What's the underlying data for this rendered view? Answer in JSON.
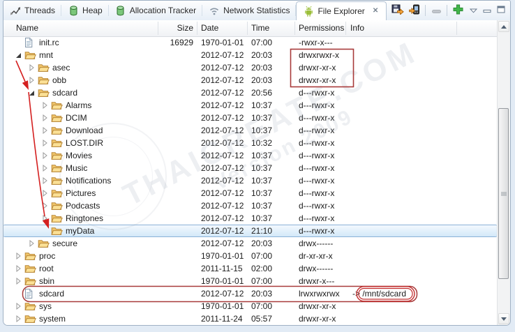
{
  "tabs": [
    {
      "label": "Threads",
      "icon": "threads-icon",
      "active": false
    },
    {
      "label": "Heap",
      "icon": "heap-icon",
      "active": false
    },
    {
      "label": "Allocation Tracker",
      "icon": "allocation-tracker-icon",
      "active": false
    },
    {
      "label": "Network Statistics",
      "icon": "network-statistics-icon",
      "active": false
    },
    {
      "label": "File Explorer",
      "icon": "android-icon",
      "active": true,
      "close_glyph": "✕"
    }
  ],
  "toolbar": {
    "buttons": [
      {
        "icon": "pull-file-icon"
      },
      {
        "icon": "push-file-icon"
      },
      {
        "icon": "delete-icon",
        "disabled": true
      },
      {
        "icon": "new-folder-icon"
      }
    ],
    "window_controls": [
      {
        "icon": "view-menu-icon"
      },
      {
        "icon": "minimize-icon"
      },
      {
        "icon": "maximize-icon"
      }
    ]
  },
  "columns": [
    "Name",
    "Size",
    "Date",
    "Time",
    "Permissions",
    "Info"
  ],
  "rows": [
    {
      "name": "init.rc",
      "icon": "file-icon",
      "level": 0,
      "expand": "none",
      "size": "16929",
      "date": "1970-01-01",
      "time": "07:00",
      "permissions": "-rwxr-x---",
      "info": "",
      "selected": false
    },
    {
      "name": "mnt",
      "icon": "folder-icon",
      "level": 0,
      "expand": "expanded",
      "size": "",
      "date": "2012-07-12",
      "time": "20:03",
      "permissions": "drwxrwxr-x",
      "info": "",
      "selected": false
    },
    {
      "name": "asec",
      "icon": "folder-icon",
      "level": 1,
      "expand": "collapsed",
      "size": "",
      "date": "2012-07-12",
      "time": "20:03",
      "permissions": "drwxr-xr-x",
      "info": "",
      "selected": false
    },
    {
      "name": "obb",
      "icon": "folder-icon",
      "level": 1,
      "expand": "collapsed",
      "size": "",
      "date": "2012-07-12",
      "time": "20:03",
      "permissions": "drwxr-xr-x",
      "info": "",
      "selected": false
    },
    {
      "name": "sdcard",
      "icon": "folder-icon",
      "level": 1,
      "expand": "expanded",
      "size": "",
      "date": "2012-07-12",
      "time": "20:56",
      "permissions": "d---rwxr-x",
      "info": "",
      "selected": false
    },
    {
      "name": "Alarms",
      "icon": "folder-icon",
      "level": 2,
      "expand": "collapsed",
      "size": "",
      "date": "2012-07-12",
      "time": "10:37",
      "permissions": "d---rwxr-x",
      "info": "",
      "selected": false
    },
    {
      "name": "DCIM",
      "icon": "folder-icon",
      "level": 2,
      "expand": "collapsed",
      "size": "",
      "date": "2012-07-12",
      "time": "10:37",
      "permissions": "d---rwxr-x",
      "info": "",
      "selected": false
    },
    {
      "name": "Download",
      "icon": "folder-icon",
      "level": 2,
      "expand": "collapsed",
      "size": "",
      "date": "2012-07-12",
      "time": "10:37",
      "permissions": "d---rwxr-x",
      "info": "",
      "selected": false
    },
    {
      "name": "LOST.DIR",
      "icon": "folder-icon",
      "level": 2,
      "expand": "collapsed",
      "size": "",
      "date": "2012-07-12",
      "time": "10:32",
      "permissions": "d---rwxr-x",
      "info": "",
      "selected": false
    },
    {
      "name": "Movies",
      "icon": "folder-icon",
      "level": 2,
      "expand": "collapsed",
      "size": "",
      "date": "2012-07-12",
      "time": "10:37",
      "permissions": "d---rwxr-x",
      "info": "",
      "selected": false
    },
    {
      "name": "Music",
      "icon": "folder-icon",
      "level": 2,
      "expand": "collapsed",
      "size": "",
      "date": "2012-07-12",
      "time": "10:37",
      "permissions": "d---rwxr-x",
      "info": "",
      "selected": false
    },
    {
      "name": "Notifications",
      "icon": "folder-icon",
      "level": 2,
      "expand": "collapsed",
      "size": "",
      "date": "2012-07-12",
      "time": "10:37",
      "permissions": "d---rwxr-x",
      "info": "",
      "selected": false
    },
    {
      "name": "Pictures",
      "icon": "folder-icon",
      "level": 2,
      "expand": "collapsed",
      "size": "",
      "date": "2012-07-12",
      "time": "10:37",
      "permissions": "d---rwxr-x",
      "info": "",
      "selected": false
    },
    {
      "name": "Podcasts",
      "icon": "folder-icon",
      "level": 2,
      "expand": "collapsed",
      "size": "",
      "date": "2012-07-12",
      "time": "10:37",
      "permissions": "d---rwxr-x",
      "info": "",
      "selected": false
    },
    {
      "name": "Ringtones",
      "icon": "folder-icon",
      "level": 2,
      "expand": "collapsed",
      "size": "",
      "date": "2012-07-12",
      "time": "10:37",
      "permissions": "d---rwxr-x",
      "info": "",
      "selected": false
    },
    {
      "name": "myData",
      "icon": "folder-icon",
      "level": 2,
      "expand": "none",
      "size": "",
      "date": "2012-07-12",
      "time": "21:10",
      "permissions": "d---rwxr-x",
      "info": "",
      "selected": true
    },
    {
      "name": "secure",
      "icon": "folder-icon",
      "level": 1,
      "expand": "collapsed",
      "size": "",
      "date": "2012-07-12",
      "time": "20:03",
      "permissions": "drwx------",
      "info": "",
      "selected": false
    },
    {
      "name": "proc",
      "icon": "folder-icon",
      "level": 0,
      "expand": "collapsed",
      "size": "",
      "date": "1970-01-01",
      "time": "07:00",
      "permissions": "dr-xr-xr-x",
      "info": "",
      "selected": false
    },
    {
      "name": "root",
      "icon": "folder-icon",
      "level": 0,
      "expand": "collapsed",
      "size": "",
      "date": "2011-11-15",
      "time": "02:00",
      "permissions": "drwx------",
      "info": "",
      "selected": false
    },
    {
      "name": "sbin",
      "icon": "folder-icon",
      "level": 0,
      "expand": "collapsed",
      "size": "",
      "date": "1970-01-01",
      "time": "07:00",
      "permissions": "drwxr-x---",
      "info": "",
      "selected": false
    },
    {
      "name": "sdcard",
      "icon": "file-icon",
      "level": 0,
      "expand": "none",
      "size": "",
      "date": "2012-07-12",
      "time": "20:03",
      "permissions": "lrwxrwxrwx",
      "info": "-> /mnt/sdcard",
      "selected": false
    },
    {
      "name": "sys",
      "icon": "folder-icon",
      "level": 0,
      "expand": "collapsed",
      "size": "",
      "date": "1970-01-01",
      "time": "07:00",
      "permissions": "drwxr-xr-x",
      "info": "",
      "selected": false
    },
    {
      "name": "system",
      "icon": "folder-icon",
      "level": 0,
      "expand": "collapsed",
      "size": "",
      "date": "2011-11-24",
      "time": "05:57",
      "permissions": "drwxr-xr-x",
      "info": "",
      "selected": false
    }
  ],
  "annotations": {
    "highlight_color": "#b83636",
    "arrow_color": "#d42020",
    "boxed_permissions": [
      "drwxrwxr-x",
      "drwxr-xr-x",
      "drwxr-xr-x"
    ],
    "boxed_row": "sdcard",
    "circled_text": "/mnt/sdcard"
  },
  "watermark": {
    "line1": "THAICREATE.COM",
    "line2": "Version 2009"
  }
}
